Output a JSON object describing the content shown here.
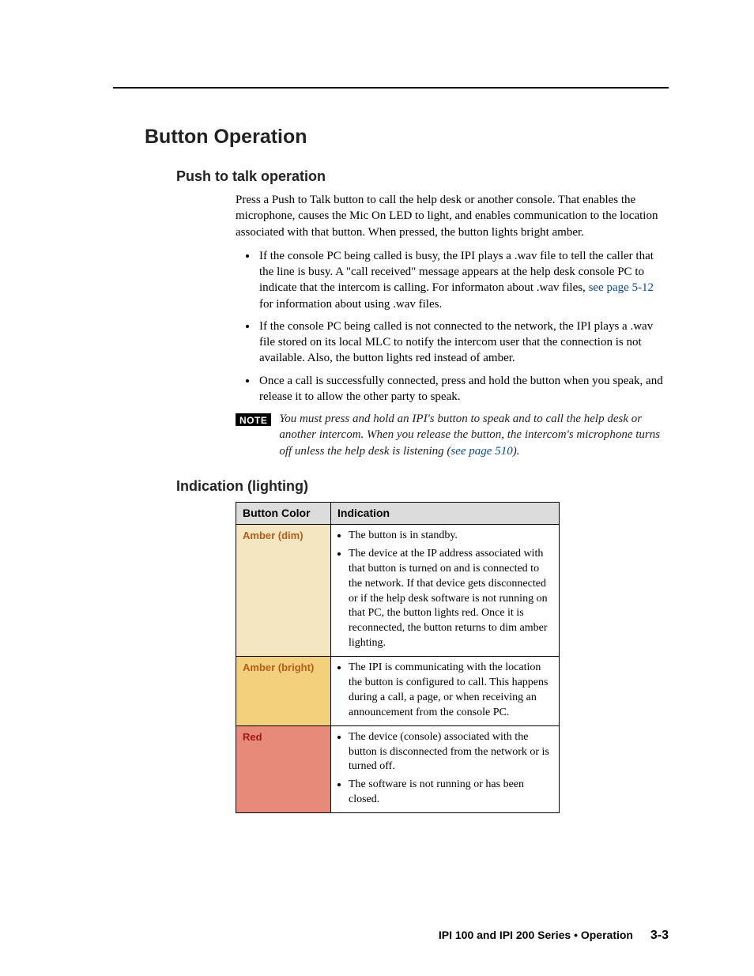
{
  "h1": "Button Operation",
  "sectionA": {
    "title": "Push to talk operation",
    "intro": "Press a Push to Talk button to call the help desk or another console.  That enables the microphone, causes the Mic On LED to light, and enables communication to the location associated with that button.  When pressed, the button lights bright amber.",
    "bullets": [
      {
        "pre": "If the console PC being called is busy, the IPI plays a .wav file to tell the caller that the line is busy.  A \"call received\" message appears at the help desk console PC to indicate that the intercom is calling.  For informaton about .wav files, ",
        "link": "see page 5-12",
        "post": " for information about using .wav files."
      },
      {
        "pre": "If the console PC being called is not connected to the network, the IPI plays a .wav file stored on its local MLC to notify the intercom user that the connection is not available.  Also, the button lights red instead of amber.",
        "link": "",
        "post": ""
      },
      {
        "pre": "Once a call is successfully connected, press and hold the button when you speak, and release it to allow the other party to speak.",
        "link": "",
        "post": ""
      }
    ],
    "note": {
      "badge": "NOTE",
      "text_pre": "You must press and hold an IPI's button to speak and to call the help desk or another intercom.  When you release the button, the intercom's microphone turns off unless the help desk is listening (",
      "link": "see page 510",
      "text_post": ")."
    }
  },
  "sectionB": {
    "title": "Indication (lighting)",
    "table": {
      "headers": [
        "Button Color",
        "Indication"
      ],
      "rows": [
        {
          "color_label": "Amber (dim)",
          "color_class": "amber-dim",
          "points": [
            "The button is in standby.",
            "The device at the IP address associated with that button is turned on and is connected to the network.  If that device gets disconnected or if the help desk software is not running on that PC, the button lights red.  Once it is reconnected, the button returns to dim amber lighting."
          ]
        },
        {
          "color_label": "Amber (bright)",
          "color_class": "amber-bright",
          "points": [
            "The IPI is communicating with the location the button is configured to call.  This happens during a call, a page, or when receiving an announcement from the console PC."
          ]
        },
        {
          "color_label": "Red",
          "color_class": "red-cell",
          "points": [
            "The device (console) associated with the button is disconnected from the network or is turned off.",
            "The software is not running or has been closed."
          ]
        }
      ]
    }
  },
  "footer": {
    "text": "IPI 100 and IPI 200 Series • Operation",
    "page": "3-3"
  }
}
